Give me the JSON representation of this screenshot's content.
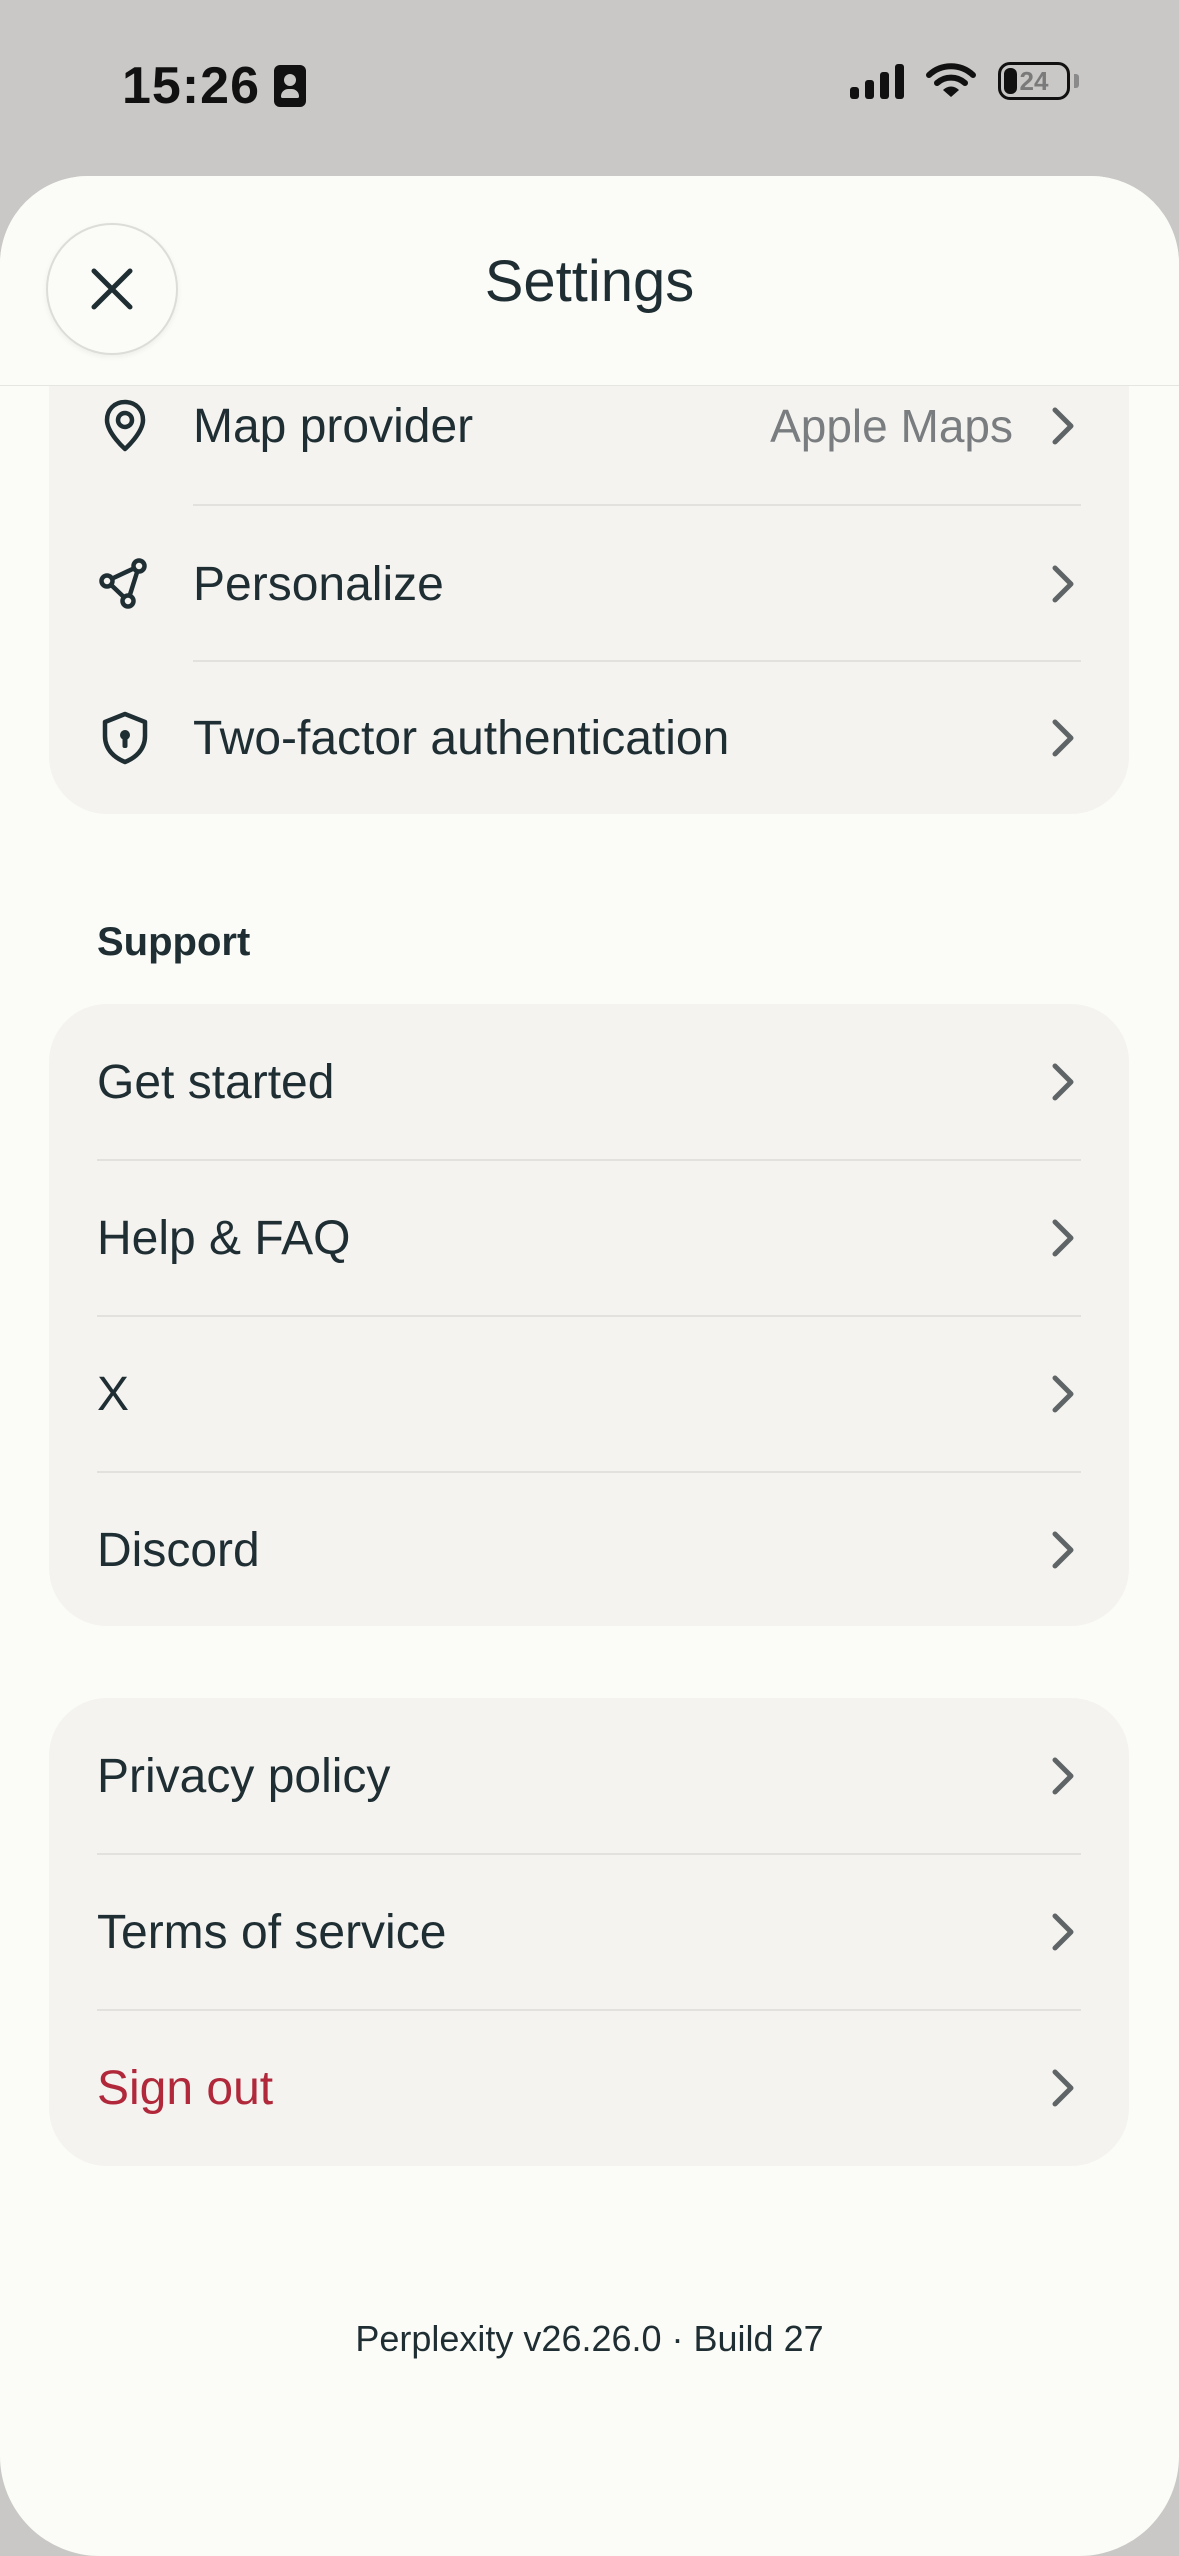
{
  "status_bar": {
    "time": "15:26",
    "battery": "24"
  },
  "header": {
    "title": "Settings"
  },
  "account_group": {
    "items": [
      {
        "label": "Map provider",
        "value": "Apple Maps"
      },
      {
        "label": "Personalize"
      },
      {
        "label": "Two-factor authentication"
      }
    ]
  },
  "support": {
    "title": "Support",
    "items": [
      {
        "label": "Get started"
      },
      {
        "label": "Help & FAQ"
      },
      {
        "label": "X"
      },
      {
        "label": "Discord"
      }
    ]
  },
  "legal": {
    "items": [
      {
        "label": "Privacy policy"
      },
      {
        "label": "Terms of service"
      },
      {
        "label": "Sign out"
      }
    ]
  },
  "footer": {
    "version": "Perplexity v26.26.0 · Build 27"
  },
  "colors": {
    "danger": "#b0283a",
    "sheet": "#fbfbf7",
    "card": "#f4f3f0"
  }
}
